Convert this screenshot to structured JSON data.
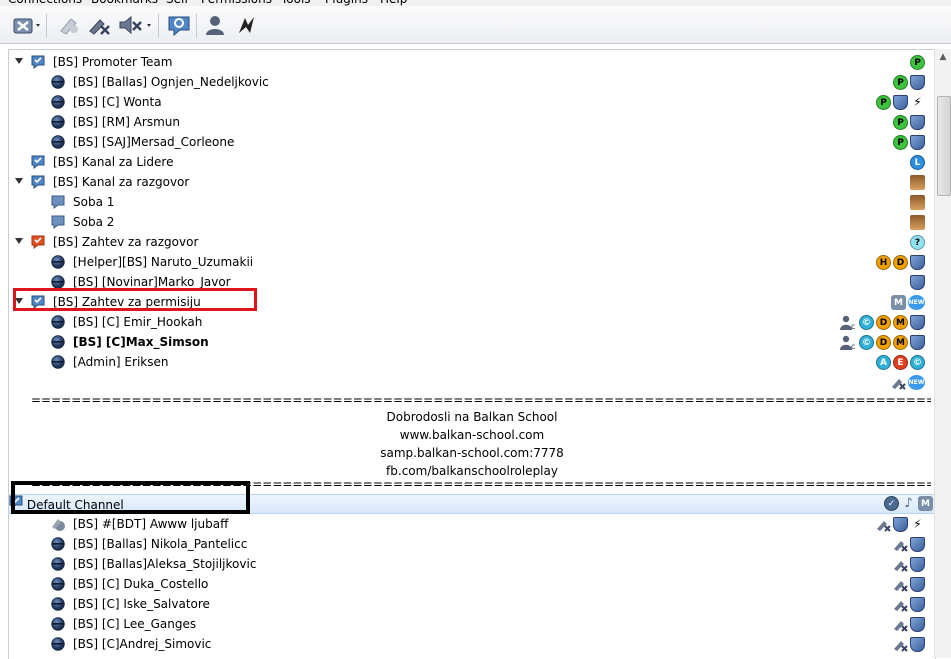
{
  "menu": [
    "Connections",
    "Bookmarks",
    "Self",
    "Permissions",
    "Tools",
    "Plugins",
    "Help"
  ],
  "toolbar": [
    "disconnect-icon",
    "away-icon",
    "mute-microphone-icon",
    "mute-speakers-icon",
    "chat-icon",
    "contacts-icon",
    "whisper-icon"
  ],
  "tree": [
    {
      "type": "channel",
      "label": "[BS] Promoter Team",
      "expanded": true,
      "icons": [
        "badge:P:green"
      ]
    },
    {
      "type": "client",
      "label": "[BS] [Ballas] Ognjen_Nedeljkovic",
      "icons": [
        "badge:P:green",
        "shield"
      ]
    },
    {
      "type": "client",
      "label": "[BS] [C] Wonta",
      "icons": [
        "badge:P:green",
        "shield",
        "whisper"
      ]
    },
    {
      "type": "client",
      "label": "[BS] [RM] Arsmun",
      "icons": [
        "badge:P:green",
        "shield"
      ]
    },
    {
      "type": "client",
      "label": "[BS] [SAJ]Mersad_Corleone",
      "icons": [
        "badge:P:green",
        "shield"
      ]
    },
    {
      "type": "channel",
      "label": "[BS] Kanal za Lidere",
      "expanded": false,
      "icons": [
        "badge:L:blue"
      ]
    },
    {
      "type": "channel",
      "label": "[BS] Kanal za razgovor",
      "expanded": true,
      "icons": [
        "avatar"
      ]
    },
    {
      "type": "subchannel",
      "label": "Soba 1",
      "icons": [
        "avatar"
      ]
    },
    {
      "type": "subchannel",
      "label": "Soba 2",
      "icons": [
        "avatar"
      ]
    },
    {
      "type": "channel-red",
      "label": "[BS] Zahtev za razgovor",
      "expanded": true,
      "icons": [
        "badge:?:cyan"
      ]
    },
    {
      "type": "client",
      "label": "[Helper][BS] Naruto_Uzumakii",
      "icons": [
        "badge:H:orange",
        "badge:D:orange",
        "shield"
      ]
    },
    {
      "type": "client",
      "label": "[BS] [Novinar]Marko_Javor",
      "icons": [
        "shield"
      ]
    },
    {
      "type": "channel",
      "label": "[BS] Zahtev za permisiju",
      "expanded": true,
      "icons": [
        "sq:M",
        "new"
      ]
    },
    {
      "type": "client",
      "label": "[BS] [C] Emir_Hookah",
      "icons": [
        "contact-c",
        "badge:©:teal",
        "badge:D:orange",
        "badge:M:orange",
        "shield"
      ]
    },
    {
      "type": "client",
      "label": "[BS] [C]Max_Simson",
      "bold": true,
      "icons": [
        "contact-c",
        "badge:©:teal",
        "badge:D:orange",
        "badge:M:orange",
        "shield"
      ]
    },
    {
      "type": "client",
      "label": "[Admin] Eriksen",
      "icons": [
        "badge:A:teal",
        "badge:E:red",
        "badge:©:teal"
      ]
    },
    {
      "type": "empty",
      "label": "",
      "icons": [
        "mute",
        "new"
      ]
    }
  ],
  "banner": {
    "separator": "================================================================================================================================================================",
    "lines": [
      "Dobrodosli na Balkan School",
      "www.balkan-school.com",
      "samp.balkan-school.com:7778",
      "fb.com/balkanschoolroleplay"
    ]
  },
  "default_channel": {
    "label": "Default Channel",
    "icons": [
      "check",
      "music",
      "sq:M"
    ]
  },
  "default_clients": [
    {
      "label": "[BS] #[BDT] Awww ljubaff",
      "away": true,
      "icons": [
        "mute",
        "shield",
        "whisper"
      ]
    },
    {
      "label": "[BS] [Ballas] Nikola_Pantelicc",
      "icons": [
        "mute",
        "shield"
      ]
    },
    {
      "label": "[BS] [Ballas]Aleksa_Stojiljkovic",
      "icons": [
        "mute",
        "shield"
      ]
    },
    {
      "label": "[BS] [C] Duka_Costello",
      "icons": [
        "mute",
        "shield"
      ]
    },
    {
      "label": "[BS] [C] Iske_Salvatore",
      "icons": [
        "mute",
        "shield"
      ]
    },
    {
      "label": "[BS] [C] Lee_Ganges",
      "icons": [
        "mute",
        "shield"
      ]
    },
    {
      "label": "[BS] [C]Andrej_Simovic",
      "icons": [
        "mute",
        "shield"
      ]
    }
  ]
}
